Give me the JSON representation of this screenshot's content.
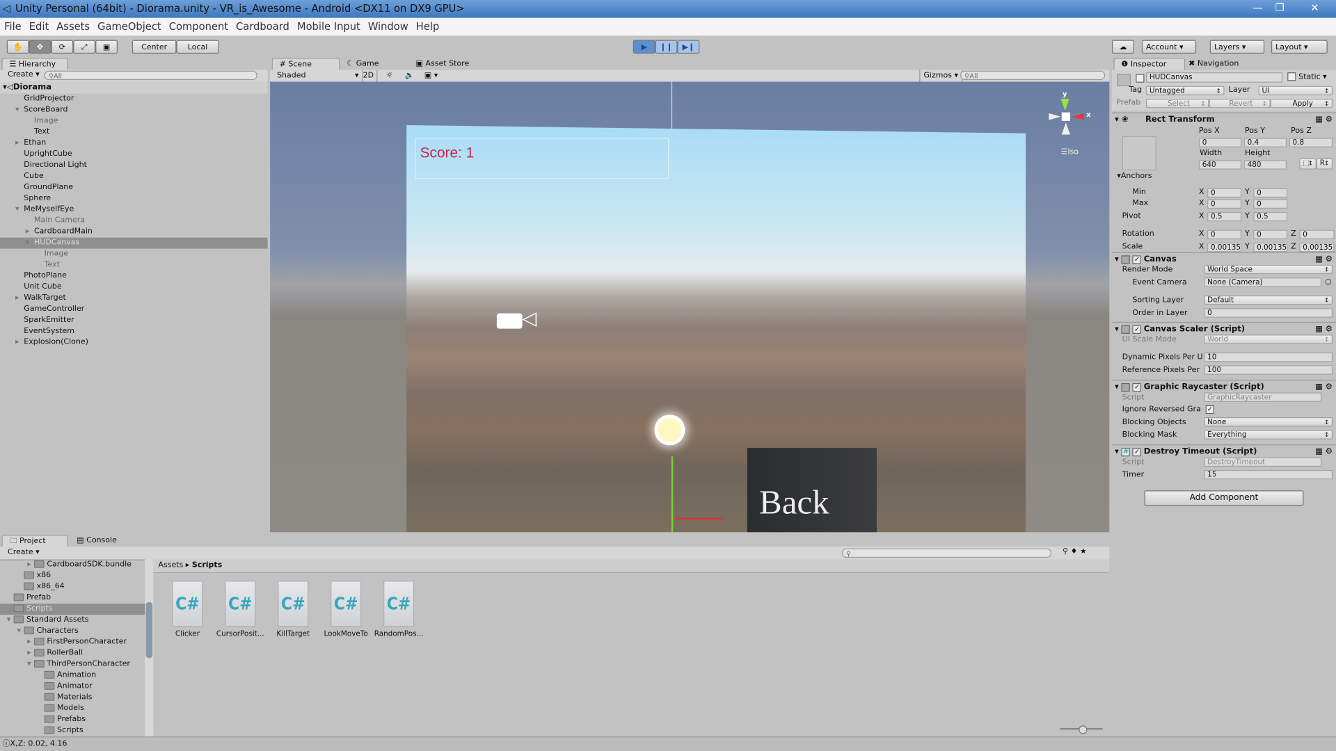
{
  "window": {
    "title": "Unity Personal (64bit) - Diorama.unity - VR_is_Awesome - Android <DX11 on DX9 GPU>"
  },
  "menu": [
    "File",
    "Edit",
    "Assets",
    "GameObject",
    "Component",
    "Cardboard",
    "Mobile Input",
    "Window",
    "Help"
  ],
  "toolbar": {
    "pivot": "Center",
    "space": "Local",
    "account": "Account",
    "layers": "Layers",
    "layout": "Layout"
  },
  "hierarchy": {
    "tab": "Hierarchy",
    "create": "Create",
    "search_placeholder": "All",
    "scene": "Diorama",
    "items": [
      {
        "label": "GridProjector",
        "depth": 1
      },
      {
        "label": "ScoreBoard",
        "depth": 1,
        "arrow": "open"
      },
      {
        "label": "Image",
        "depth": 2,
        "dim": true
      },
      {
        "label": "Text",
        "depth": 2
      },
      {
        "label": "Ethan",
        "depth": 1,
        "arrow": "closed"
      },
      {
        "label": "UprightCube",
        "depth": 1
      },
      {
        "label": "Directional Light",
        "depth": 1
      },
      {
        "label": "Cube",
        "depth": 1
      },
      {
        "label": "GroundPlane",
        "depth": 1
      },
      {
        "label": "Sphere",
        "depth": 1
      },
      {
        "label": "MeMyselfEye",
        "depth": 1,
        "arrow": "open"
      },
      {
        "label": "Main Camera",
        "depth": 2,
        "dim": true
      },
      {
        "label": "CardboardMain",
        "depth": 2,
        "arrow": "closed"
      },
      {
        "label": "HUDCanvas",
        "depth": 2,
        "arrow": "open",
        "selected": true
      },
      {
        "label": "Image",
        "depth": 3,
        "dim": true
      },
      {
        "label": "Text",
        "depth": 3,
        "dim": true
      },
      {
        "label": "PhotoPlane",
        "depth": 1
      },
      {
        "label": "Unit Cube",
        "depth": 1
      },
      {
        "label": "WalkTarget",
        "depth": 1,
        "arrow": "closed"
      },
      {
        "label": "GameController",
        "depth": 1
      },
      {
        "label": "SparkEmitter",
        "depth": 1
      },
      {
        "label": "EventSystem",
        "depth": 1
      },
      {
        "label": "Explosion(Clone)",
        "depth": 1,
        "arrow": "closed"
      }
    ]
  },
  "scene": {
    "tabs": [
      "Scene",
      "Game",
      "Asset Store"
    ],
    "shading": "Shaded",
    "mode2d": "2D",
    "gizmos": "Gizmos",
    "search_placeholder": "All",
    "score_text": "Score: 1",
    "iso": "Iso",
    "axis_y": "y",
    "axis_x": "x",
    "cube_text": "Back",
    "score_color": "#d0204a"
  },
  "inspector": {
    "tabs": [
      "Inspector",
      "Navigation"
    ],
    "object_name": "HUDCanvas",
    "static": "Static",
    "tag_label": "Tag",
    "tag": "Untagged",
    "layer_label": "Layer",
    "layer": "UI",
    "prefab": "Prefab",
    "select": "Select",
    "revert": "Revert",
    "apply": "Apply",
    "rect": {
      "title": "Rect Transform",
      "pos_x_label": "Pos X",
      "pos_y_label": "Pos Y",
      "pos_z_label": "Pos Z",
      "pos_x": "0",
      "pos_y": "0.4",
      "pos_z": "0.8",
      "width_label": "Width",
      "height_label": "Height",
      "width": "640",
      "height": "480",
      "r": "R",
      "anchors": "Anchors",
      "min": "Min",
      "max": "Max",
      "pivot": "Pivot",
      "rotation": "Rotation",
      "scale": "Scale",
      "X": "X",
      "Y": "Y",
      "Z": "Z",
      "min_x": "0",
      "min_y": "0",
      "max_x": "0",
      "max_y": "0",
      "pivot_x": "0.5",
      "pivot_y": "0.5",
      "rot_x": "0",
      "rot_y": "0",
      "rot_z": "0",
      "scale_x": "0.00135",
      "scale_y": "0.00135",
      "scale_z": "0.00135"
    },
    "canvas": {
      "title": "Canvas",
      "render_mode_label": "Render Mode",
      "render_mode": "World Space",
      "event_camera_label": "Event Camera",
      "event_camera": "None (Camera)",
      "sorting_layer_label": "Sorting Layer",
      "sorting_layer": "Default",
      "order_label": "Order in Layer",
      "order": "0"
    },
    "scaler": {
      "title": "Canvas Scaler (Script)",
      "ui_scale_label": "UI Scale Mode",
      "ui_scale": "World",
      "dynamic_label": "Dynamic Pixels Per U",
      "dynamic": "10",
      "reference_label": "Reference Pixels Per",
      "reference": "100"
    },
    "raycaster": {
      "title": "Graphic Raycaster (Script)",
      "script_label": "Script",
      "script": "GraphicRaycaster",
      "ignore_label": "Ignore Reversed Gra",
      "blocking_objects_label": "Blocking Objects",
      "blocking_objects": "None",
      "blocking_mask_label": "Blocking Mask",
      "blocking_mask": "Everything"
    },
    "timeout": {
      "title": "Destroy Timeout (Script)",
      "script_label": "Script",
      "script": "DestroyTimeout",
      "timer_label": "Timer",
      "timer": "15"
    },
    "add_component": "Add Component"
  },
  "project": {
    "tabs": [
      "Project",
      "Console"
    ],
    "create": "Create",
    "breadcrumb": [
      "Assets",
      "Scripts"
    ],
    "tree": [
      {
        "label": "CardboardSDK.bundle",
        "depth": 3,
        "arrow": "closed"
      },
      {
        "label": "x86",
        "depth": 2
      },
      {
        "label": "x86_64",
        "depth": 2
      },
      {
        "label": "Prefab",
        "depth": 1
      },
      {
        "label": "Scripts",
        "depth": 1,
        "selected": true
      },
      {
        "label": "Standard Assets",
        "depth": 1,
        "arrow": "open"
      },
      {
        "label": "Characters",
        "depth": 2,
        "arrow": "open"
      },
      {
        "label": "FirstPersonCharacter",
        "depth": 3,
        "arrow": "closed"
      },
      {
        "label": "RollerBall",
        "depth": 3,
        "arrow": "closed"
      },
      {
        "label": "ThirdPersonCharacter",
        "depth": 3,
        "arrow": "open"
      },
      {
        "label": "Animation",
        "depth": 4
      },
      {
        "label": "Animator",
        "depth": 4
      },
      {
        "label": "Materials",
        "depth": 4
      },
      {
        "label": "Models",
        "depth": 4
      },
      {
        "label": "Prefabs",
        "depth": 4
      },
      {
        "label": "Scripts",
        "depth": 4
      }
    ],
    "files": [
      "Clicker",
      "CursorPosit...",
      "KillTarget",
      "LookMoveTo",
      "RandomPos..."
    ],
    "file_glyph": "C#"
  },
  "status": {
    "text": "X,Z: 0.02, 4.16"
  }
}
